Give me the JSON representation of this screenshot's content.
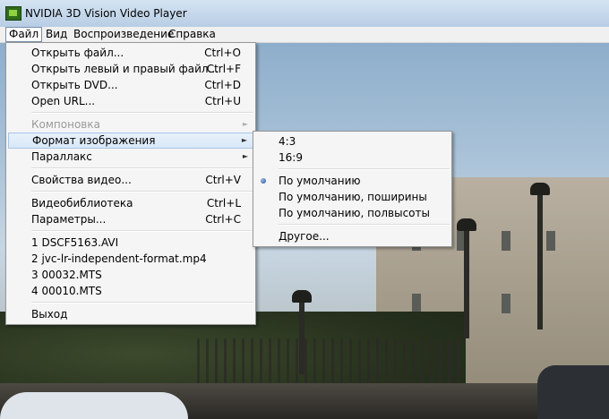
{
  "window": {
    "title": "NVIDIA 3D Vision Video Player"
  },
  "menubar": {
    "file": "Файл",
    "view": "Вид",
    "playback": "Воспроизведение",
    "help": "Справка"
  },
  "file_menu": {
    "items": [
      {
        "label": "Открыть файл...",
        "shortcut": "Ctrl+O"
      },
      {
        "label": "Открыть левый и правый файл...",
        "shortcut": "Ctrl+F"
      },
      {
        "label": "Открыть DVD...",
        "shortcut": "Ctrl+D"
      },
      {
        "label": "Open URL...",
        "shortcut": "Ctrl+U"
      },
      {
        "label": "Компоновка",
        "disabled": true
      },
      {
        "label": "Формат изображения",
        "highlighted": true
      },
      {
        "label": "Параллакс"
      },
      {
        "label": "Свойства видео...",
        "shortcut": "Ctrl+V"
      },
      {
        "label": "Видеобиблиотека",
        "shortcut": "Ctrl+L"
      },
      {
        "label": "Параметры...",
        "shortcut": "Ctrl+C"
      },
      {
        "label": "1 DSCF5163.AVI"
      },
      {
        "label": "2 jvc-lr-independent-format.mp4"
      },
      {
        "label": "3 00032.MTS"
      },
      {
        "label": "4 00010.MTS"
      },
      {
        "label": "Выход"
      }
    ]
  },
  "aspect_submenu": {
    "items": [
      {
        "label": "4:3"
      },
      {
        "label": "16:9"
      },
      {
        "label": "По умолчанию",
        "selected": true
      },
      {
        "label": "По умолчанию, поширины"
      },
      {
        "label": "По умолчанию, полвысоты"
      },
      {
        "label": "Другое..."
      }
    ]
  },
  "icons": {
    "submenu_arrow": "►",
    "app_icon": "nvidia-logo-icon",
    "radio": "radio-selected-icon"
  }
}
